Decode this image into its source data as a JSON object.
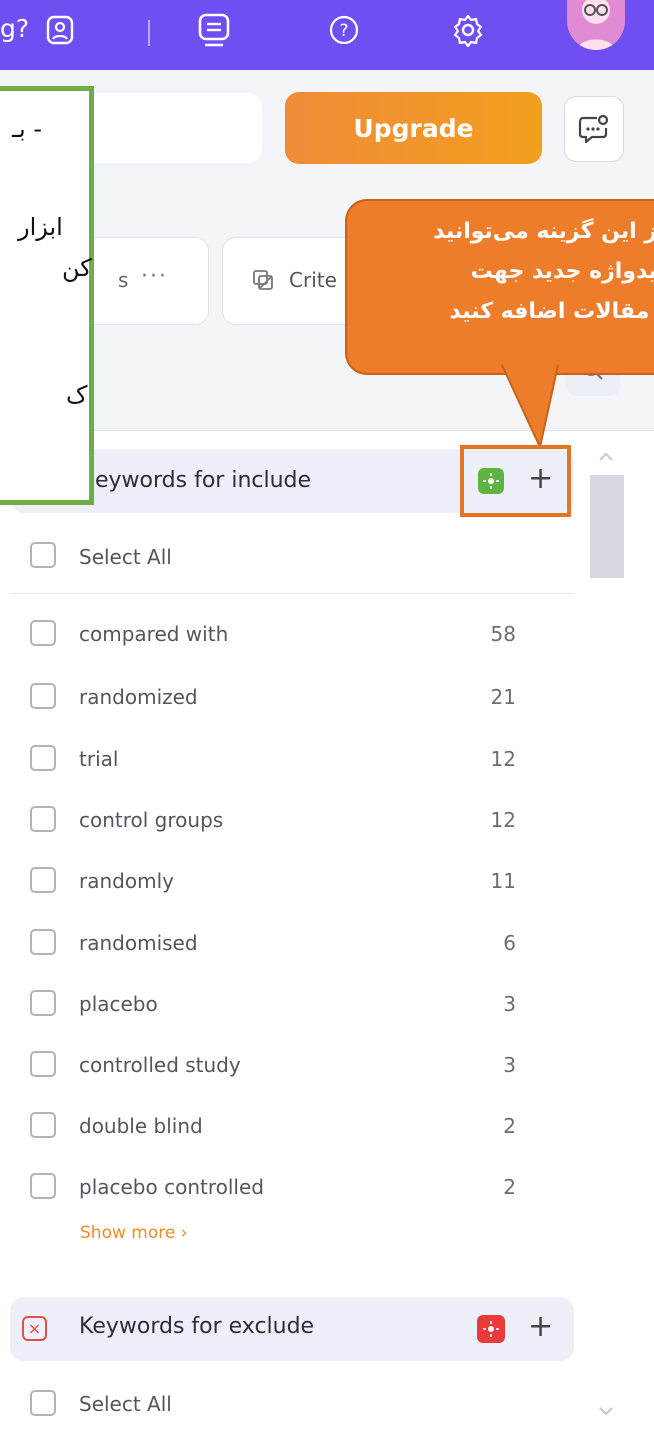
{
  "topbar": {
    "partial_text": "g?",
    "icons": [
      "user-badge-icon",
      "keyboard-icon",
      "help-icon",
      "gear-icon",
      "avatar"
    ]
  },
  "toolbar": {
    "upgrade_label": "Upgrade"
  },
  "tabs": {
    "first_partial": "s",
    "first_menu": "···",
    "second_partial": "Crite"
  },
  "note": {
    "line1": "- بـ",
    "line2": "ابزار",
    "line3": "کن",
    "line4": "ک"
  },
  "callout": {
    "line1": "ز این گزینه می‌توانید",
    "line2": "ّیدواژه جدید جهت",
    "line3": "ّ مقالات اضافه کنید"
  },
  "include_group": {
    "title": "eywords for include",
    "select_all": "Select All",
    "items": [
      {
        "label": "compared with",
        "count": "58"
      },
      {
        "label": "randomized",
        "count": "21"
      },
      {
        "label": "trial",
        "count": "12"
      },
      {
        "label": "control groups",
        "count": "12"
      },
      {
        "label": "randomly",
        "count": "11"
      },
      {
        "label": "randomised",
        "count": "6"
      },
      {
        "label": "placebo",
        "count": "3"
      },
      {
        "label": "controlled study",
        "count": "3"
      },
      {
        "label": "double blind",
        "count": "2"
      },
      {
        "label": "placebo controlled",
        "count": "2"
      }
    ],
    "show_more": "Show more ›"
  },
  "exclude_group": {
    "title": "Keywords for exclude",
    "select_all": "Select All"
  },
  "colors": {
    "brand": "#6f4ef2",
    "accent_orange": "#ee7d2b",
    "note_border": "#70ad47"
  }
}
